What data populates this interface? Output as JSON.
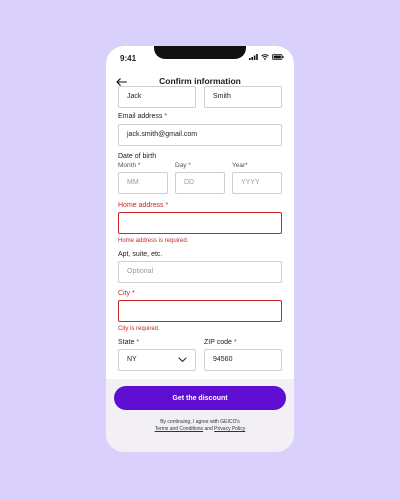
{
  "status_bar": {
    "time": "9:41"
  },
  "nav": {
    "title": "Confirm information"
  },
  "form": {
    "first_name_value": "Jack",
    "last_name_value": "Smith",
    "email_label": "Email address",
    "email_value": "jack.smith@gmail.com",
    "dob_label": "Date of birth",
    "month_label": "Month",
    "day_label": "Day",
    "year_label": "Year",
    "month_placeholder": "MM",
    "day_placeholder": "DD",
    "year_placeholder": "YYYY",
    "home_address_label": "Home address",
    "home_address_error": "Home address is required.",
    "apt_label": "Apt, suite, etc.",
    "apt_placeholder": "Optional",
    "city_label": "City",
    "city_error": "City is required.",
    "state_label": "State",
    "state_value": "NY",
    "zip_label": "ZIP code",
    "zip_value": "94560",
    "required_marker": "*"
  },
  "footer": {
    "cta_label": "Get the discount",
    "legal_prefix": "By continuing, I agree with GEICO's",
    "terms_link": "Terms and Conditions",
    "and_text": "and",
    "privacy_link": "Privacy Policy"
  },
  "colors": {
    "background": "#d9d0fb",
    "accent": "#5d0ed1",
    "error": "#c62828"
  }
}
